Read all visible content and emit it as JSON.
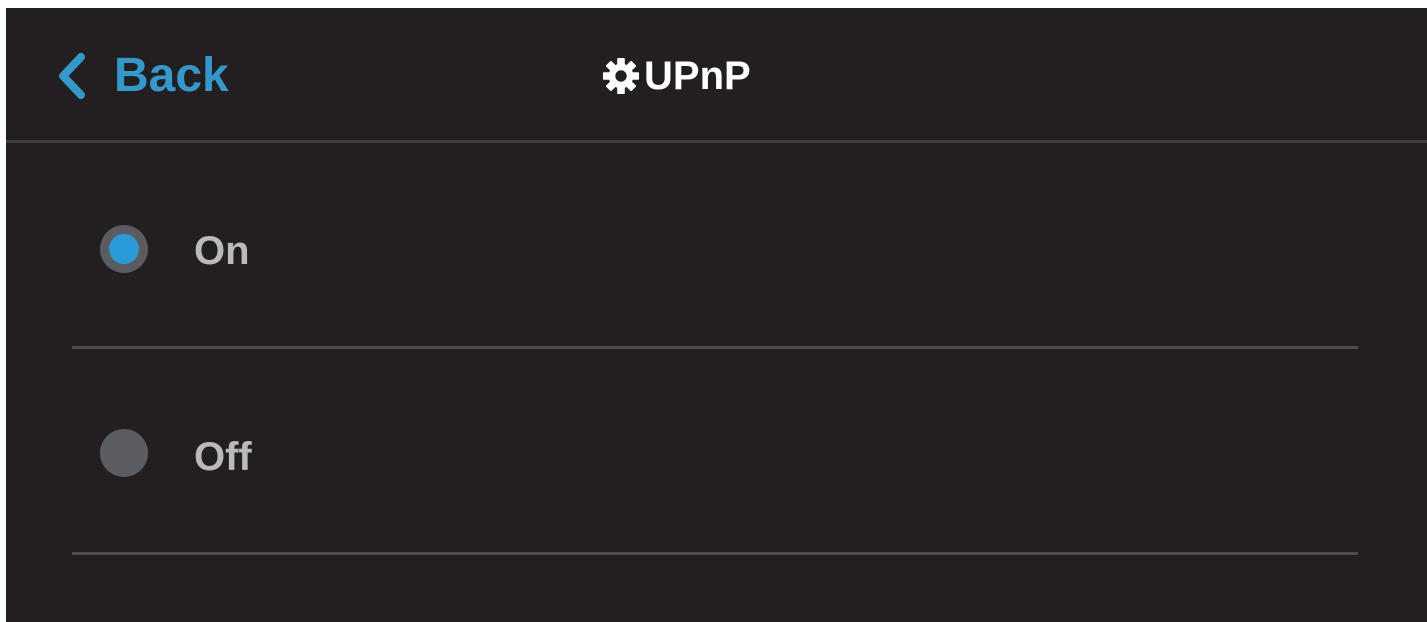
{
  "header": {
    "back_label": "Back",
    "back_icon": "chevron-left-icon",
    "title": "UPnP",
    "title_icon": "gear-icon"
  },
  "options": [
    {
      "label": "On",
      "selected": true
    },
    {
      "label": "Off",
      "selected": false
    }
  ],
  "colors": {
    "background": "#231f20",
    "accent": "#2a9bd7",
    "back_text": "#3399cc",
    "title_text": "#ffffff",
    "option_text": "#b9babd",
    "radio_unselected": "#5b5c61",
    "divider": "#4a4c52"
  }
}
